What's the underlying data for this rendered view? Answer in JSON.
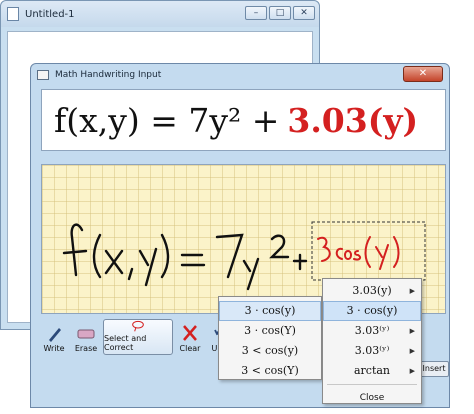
{
  "back_window": {
    "title": "Untitled-1",
    "minimize_glyph": "–",
    "maximize_glyph": "□",
    "close_glyph": "✕"
  },
  "math_window": {
    "title": "Math Handwriting Input",
    "close_glyph": "✕",
    "preview": {
      "black_part": "f(x,y) = 7y² +",
      "red_part": "3.03(y)"
    },
    "toolbar": {
      "write": "Write",
      "erase": "Erase",
      "select_correct": "Select and Correct",
      "clear": "Clear",
      "undo": "Undo"
    },
    "insert_label": "Insert"
  },
  "menu_left": {
    "items": [
      "3 · cos(y)",
      "3 · cos(Y)",
      "3 < cos(y)",
      "3 < cos(Y)"
    ]
  },
  "menu_right": {
    "items": [
      "3.03(y)",
      "3 · cos(y)",
      "3.03⁽ʸ⁾",
      "3.03⁽ʸ⁾",
      "arctan"
    ],
    "close_label": "Close"
  },
  "colors": {
    "ink": "#111111",
    "correction_ink": "#d42020",
    "pad_background": "#fbf3c9",
    "selection": "#cfe3f8"
  }
}
